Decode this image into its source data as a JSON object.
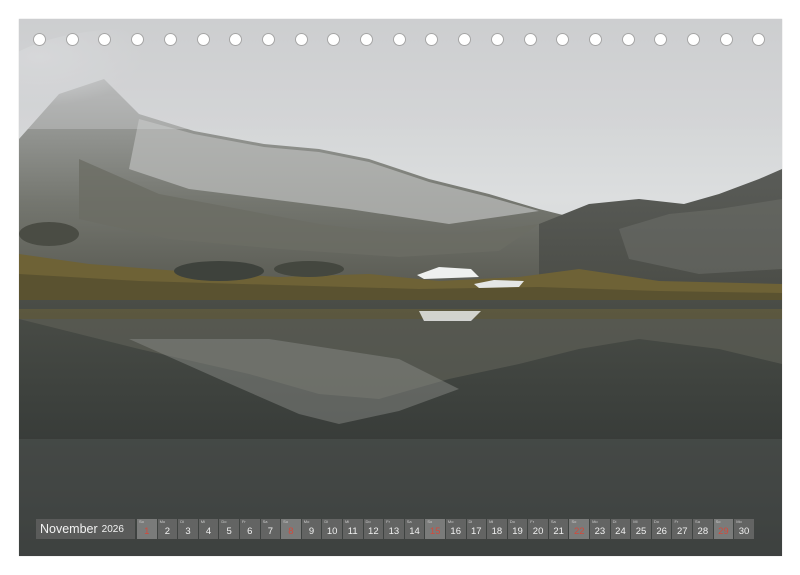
{
  "calendar": {
    "month": "November",
    "year": "2026",
    "sunday_color": "#d24a3c",
    "days": [
      {
        "n": "1",
        "wd": "So",
        "sun": true
      },
      {
        "n": "2",
        "wd": "Mo",
        "sun": false
      },
      {
        "n": "3",
        "wd": "Di",
        "sun": false
      },
      {
        "n": "4",
        "wd": "Mi",
        "sun": false
      },
      {
        "n": "5",
        "wd": "Do",
        "sun": false
      },
      {
        "n": "6",
        "wd": "Fr",
        "sun": false
      },
      {
        "n": "7",
        "wd": "Sa",
        "sun": false
      },
      {
        "n": "8",
        "wd": "So",
        "sun": true
      },
      {
        "n": "9",
        "wd": "Mo",
        "sun": false
      },
      {
        "n": "10",
        "wd": "Di",
        "sun": false
      },
      {
        "n": "11",
        "wd": "Mi",
        "sun": false
      },
      {
        "n": "12",
        "wd": "Do",
        "sun": false
      },
      {
        "n": "13",
        "wd": "Fr",
        "sun": false
      },
      {
        "n": "14",
        "wd": "Sa",
        "sun": false
      },
      {
        "n": "15",
        "wd": "So",
        "sun": true
      },
      {
        "n": "16",
        "wd": "Mo",
        "sun": false
      },
      {
        "n": "17",
        "wd": "Di",
        "sun": false
      },
      {
        "n": "18",
        "wd": "Mi",
        "sun": false
      },
      {
        "n": "19",
        "wd": "Do",
        "sun": false
      },
      {
        "n": "20",
        "wd": "Fr",
        "sun": false
      },
      {
        "n": "21",
        "wd": "Sa",
        "sun": false
      },
      {
        "n": "22",
        "wd": "So",
        "sun": true
      },
      {
        "n": "23",
        "wd": "Mo",
        "sun": false
      },
      {
        "n": "24",
        "wd": "Di",
        "sun": false
      },
      {
        "n": "25",
        "wd": "Mi",
        "sun": false
      },
      {
        "n": "26",
        "wd": "Do",
        "sun": false
      },
      {
        "n": "27",
        "wd": "Fr",
        "sun": false
      },
      {
        "n": "28",
        "wd": "Sa",
        "sun": false
      },
      {
        "n": "29",
        "wd": "So",
        "sun": true
      },
      {
        "n": "30",
        "wd": "Mo",
        "sun": false
      }
    ]
  },
  "binding": {
    "hole_icon": "ring-binding-hole-icon"
  },
  "photo": {
    "subject": "alpine-lake-reflection",
    "colors": {
      "sky": "#d3d5d6",
      "snow": "#c9cbcb",
      "mountain": "#5e605a",
      "grass": "#6e6032",
      "water": "#353836"
    }
  }
}
